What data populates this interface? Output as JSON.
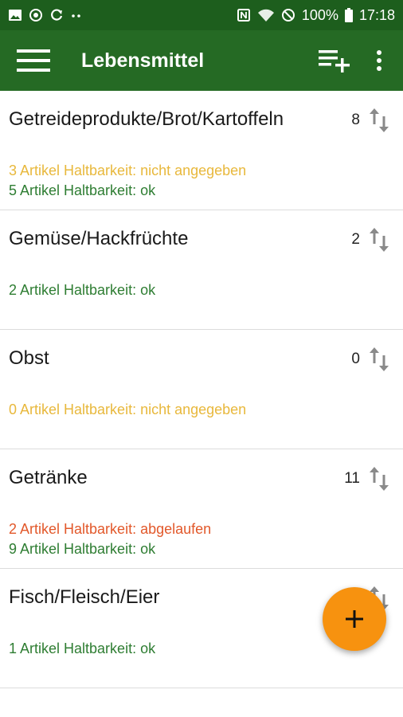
{
  "status_bar": {
    "battery_text": "100%",
    "time": "17:18",
    "left_icons": [
      "image-icon",
      "sync-icon",
      "refresh-icon",
      "more-dots-icon"
    ],
    "right_icons": [
      "nfc-icon",
      "wifi-icon",
      "do-not-disturb-icon",
      "battery-icon"
    ]
  },
  "app_bar": {
    "title": "Lebensmittel",
    "icons": [
      "menu-icon",
      "playlist-add-icon",
      "overflow-menu-icon"
    ]
  },
  "categories": [
    {
      "name": "Getreideprodukte/Brot/Kartoffeln",
      "count": "8",
      "lines": [
        {
          "text": "3 Artikel Haltbarkeit: nicht angegeben",
          "status": "unknown"
        },
        {
          "text": "5 Artikel Haltbarkeit: ok",
          "status": "ok"
        }
      ]
    },
    {
      "name": "Gemüse/Hackfrüchte",
      "count": "2",
      "lines": [
        {
          "text": "2 Artikel Haltbarkeit: ok",
          "status": "ok"
        }
      ]
    },
    {
      "name": "Obst",
      "count": "0",
      "lines": [
        {
          "text": "0 Artikel Haltbarkeit: nicht angegeben",
          "status": "unknown"
        }
      ]
    },
    {
      "name": "Getränke",
      "count": "11",
      "lines": [
        {
          "text": "2 Artikel Haltbarkeit: abgelaufen",
          "status": "expired"
        },
        {
          "text": "9 Artikel Haltbarkeit: ok",
          "status": "ok"
        }
      ]
    },
    {
      "name": "Fisch/Fleisch/Eier",
      "count": "",
      "lines": [
        {
          "text": "1 Artikel Haltbarkeit: ok",
          "status": "ok"
        }
      ]
    }
  ],
  "colors": {
    "app_bar": "#256a24",
    "status_bar": "#1d5e1d",
    "ok": "#2e7d32",
    "unknown": "#e8b83c",
    "expired": "#e2582a",
    "fab": "#f7920f"
  },
  "fab": {
    "icon": "add-icon"
  }
}
